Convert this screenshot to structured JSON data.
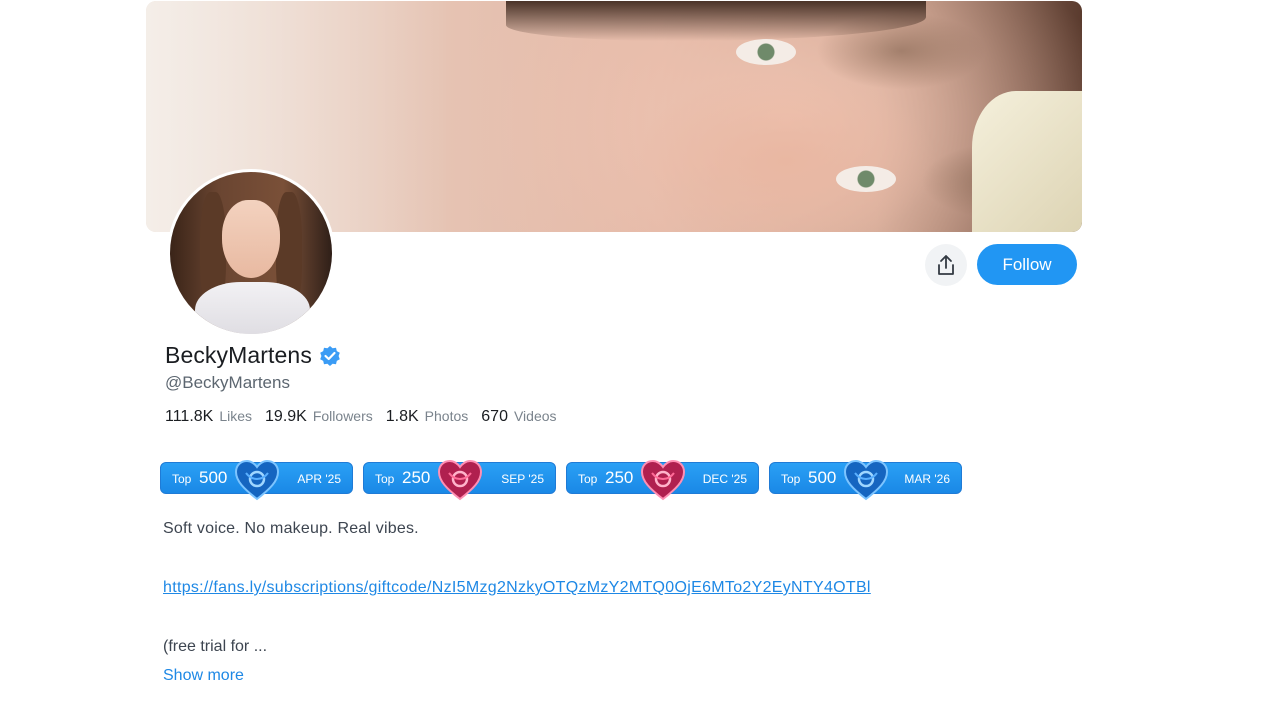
{
  "profile": {
    "display_name": "BeckyMartens",
    "handle": "@BeckyMartens",
    "verified_icon": "verified-badge-icon",
    "follow_label": "Follow",
    "share_icon": "share-icon"
  },
  "stats": [
    {
      "value": "111.8K",
      "label": "Likes"
    },
    {
      "value": "19.9K",
      "label": "Followers"
    },
    {
      "value": "1.8K",
      "label": "Photos"
    },
    {
      "value": "670",
      "label": "Videos"
    }
  ],
  "badges": [
    {
      "prefix": "Top",
      "rank": "500",
      "date": "APR '25",
      "heart": "blue"
    },
    {
      "prefix": "Top",
      "rank": "250",
      "date": "SEP '25",
      "heart": "pink"
    },
    {
      "prefix": "Top",
      "rank": "250",
      "date": "DEC '25",
      "heart": "pink"
    },
    {
      "prefix": "Top",
      "rank": "500",
      "date": "MAR '26",
      "heart": "blue"
    }
  ],
  "bio": {
    "line1": "Soft voice. No makeup. Real vibes.",
    "link": "https://fans.ly/subscriptions/giftcode/NzI5Mzg2NzkyOTQzMzY2MTQ0OjE6MTo2Y2EyNTY4OTBl",
    "line3": "(free trial for ...",
    "show_more": "Show more"
  },
  "colors": {
    "accent": "#2196f3",
    "link": "#1e88e5",
    "heart_blue": "#1a7fe0",
    "heart_pink": "#d6336c"
  }
}
